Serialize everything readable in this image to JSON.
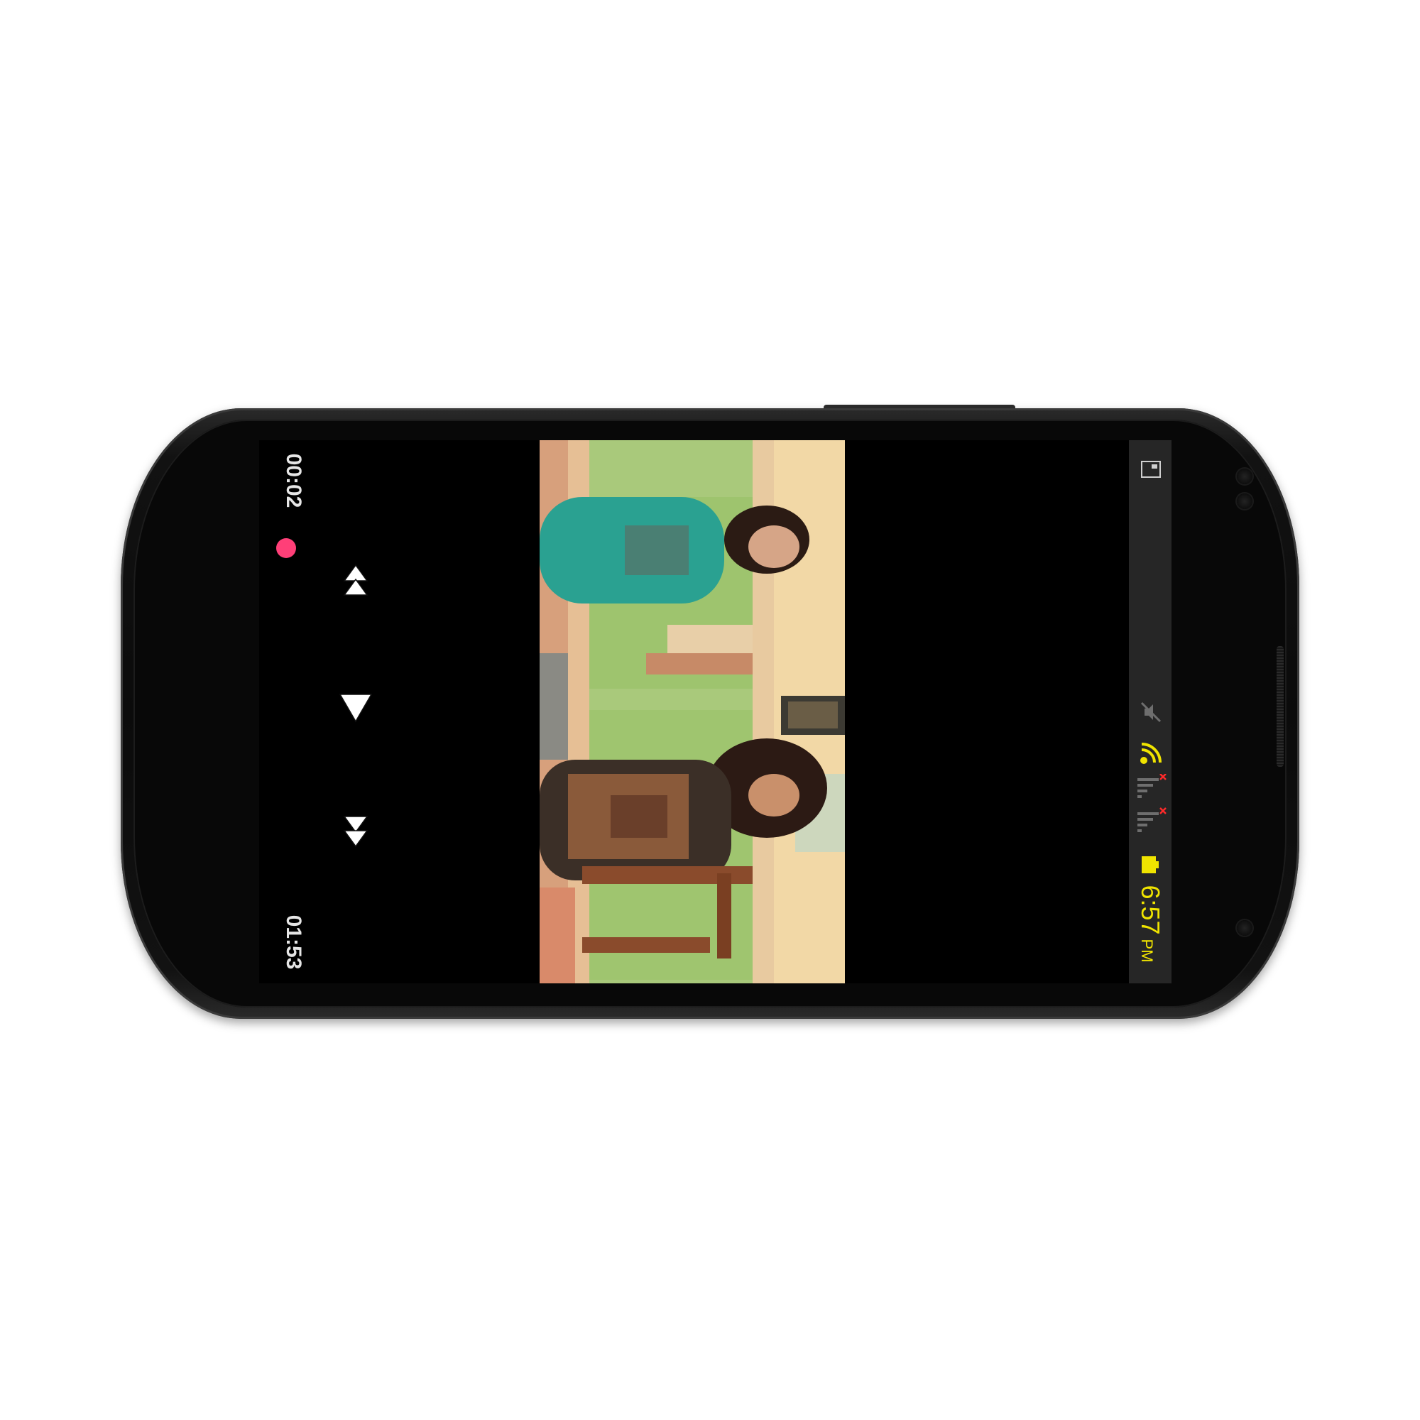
{
  "player": {
    "elapsed_time": "00:02",
    "total_time": "01:53",
    "progress_fraction": 0.018,
    "seek_color": "#ff3f78",
    "controls": {
      "rewind_icon": "rewind-icon",
      "play_icon": "play-icon",
      "forward_icon": "fast-forward-icon"
    }
  },
  "status_bar": {
    "time": "6:57",
    "ampm": "PM",
    "accent_color": "#f0e400",
    "icons": [
      "gallery-icon",
      "mute-icon",
      "wifi-icon",
      "signal-icon",
      "battery-icon"
    ]
  },
  "device": {
    "body_color": "#0b0b0b",
    "screen_color": "#000000"
  }
}
